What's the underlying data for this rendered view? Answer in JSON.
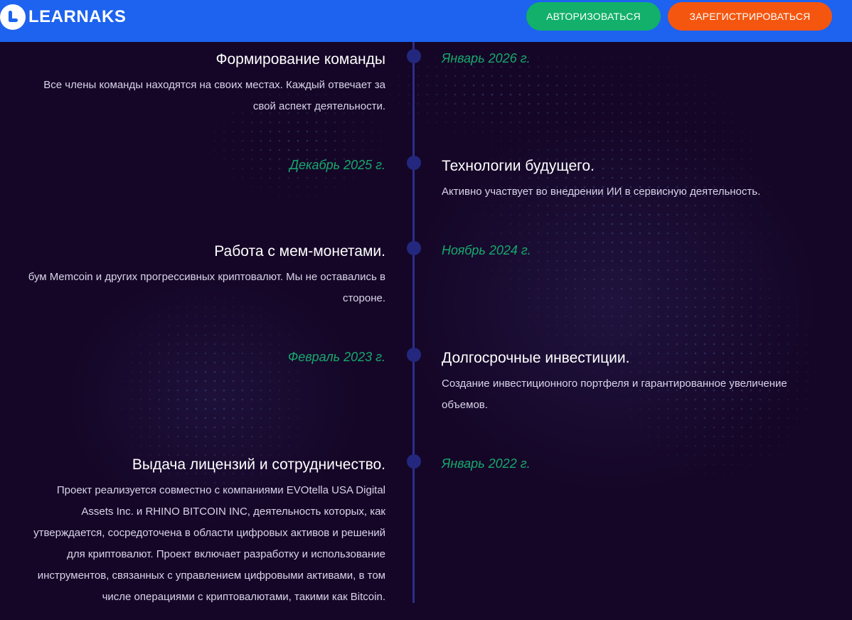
{
  "header": {
    "logo_text": "LEARNAKS",
    "login_label": "АВТОРИЗОВАТЬСЯ",
    "register_label": "ЗАРЕГИСТРИРОВАТЬСЯ"
  },
  "colors": {
    "header_bg": "#1d63f0",
    "page_bg": "#150627",
    "login_button": "#12b06a",
    "register_button": "#f5560f",
    "date_text": "#16a96c",
    "timeline_axis": "#2a2f8a"
  },
  "timeline": [
    {
      "title": "Формирование команды",
      "date": "Январь 2026 г.",
      "description_lines": [
        "Все члены команды находятся на своих местах. Каждый отвечает за",
        "свой аспект деятельности."
      ]
    },
    {
      "title": "Технологии будущего.",
      "date": "Декабрь 2025 г.",
      "description_lines": [
        "Активно участвует во внедрении ИИ в сервисную деятельность."
      ]
    },
    {
      "title": "Работа с мем-монетами.",
      "date": "Ноябрь 2024 г.",
      "description_lines": [
        "бум Memcoin и других прогрессивных криптовалют. Мы не оставались в",
        "стороне."
      ]
    },
    {
      "title": "Долгосрочные инвестиции.",
      "date": "Февраль 2023 г.",
      "description_lines": [
        "Создание инвестиционного портфеля и гарантированное увеличение",
        "объемов."
      ]
    },
    {
      "title": "Выдача лицензий и сотрудничество.",
      "date": "Январь 2022 г.",
      "description_lines": [
        "Проект реализуется совместно с компаниями EVOtella USA Digital",
        "Assets Inc. и RHINO BITCOIN INC, деятельность которых, как",
        "утверждается, сосредоточена в области цифровых активов и решений",
        "для криптовалют. Проект включает разработку и использование",
        "инструментов, связанных с управлением цифровыми активами, в том",
        "числе операциями с криптовалютами, такими как Bitcoin."
      ]
    }
  ]
}
